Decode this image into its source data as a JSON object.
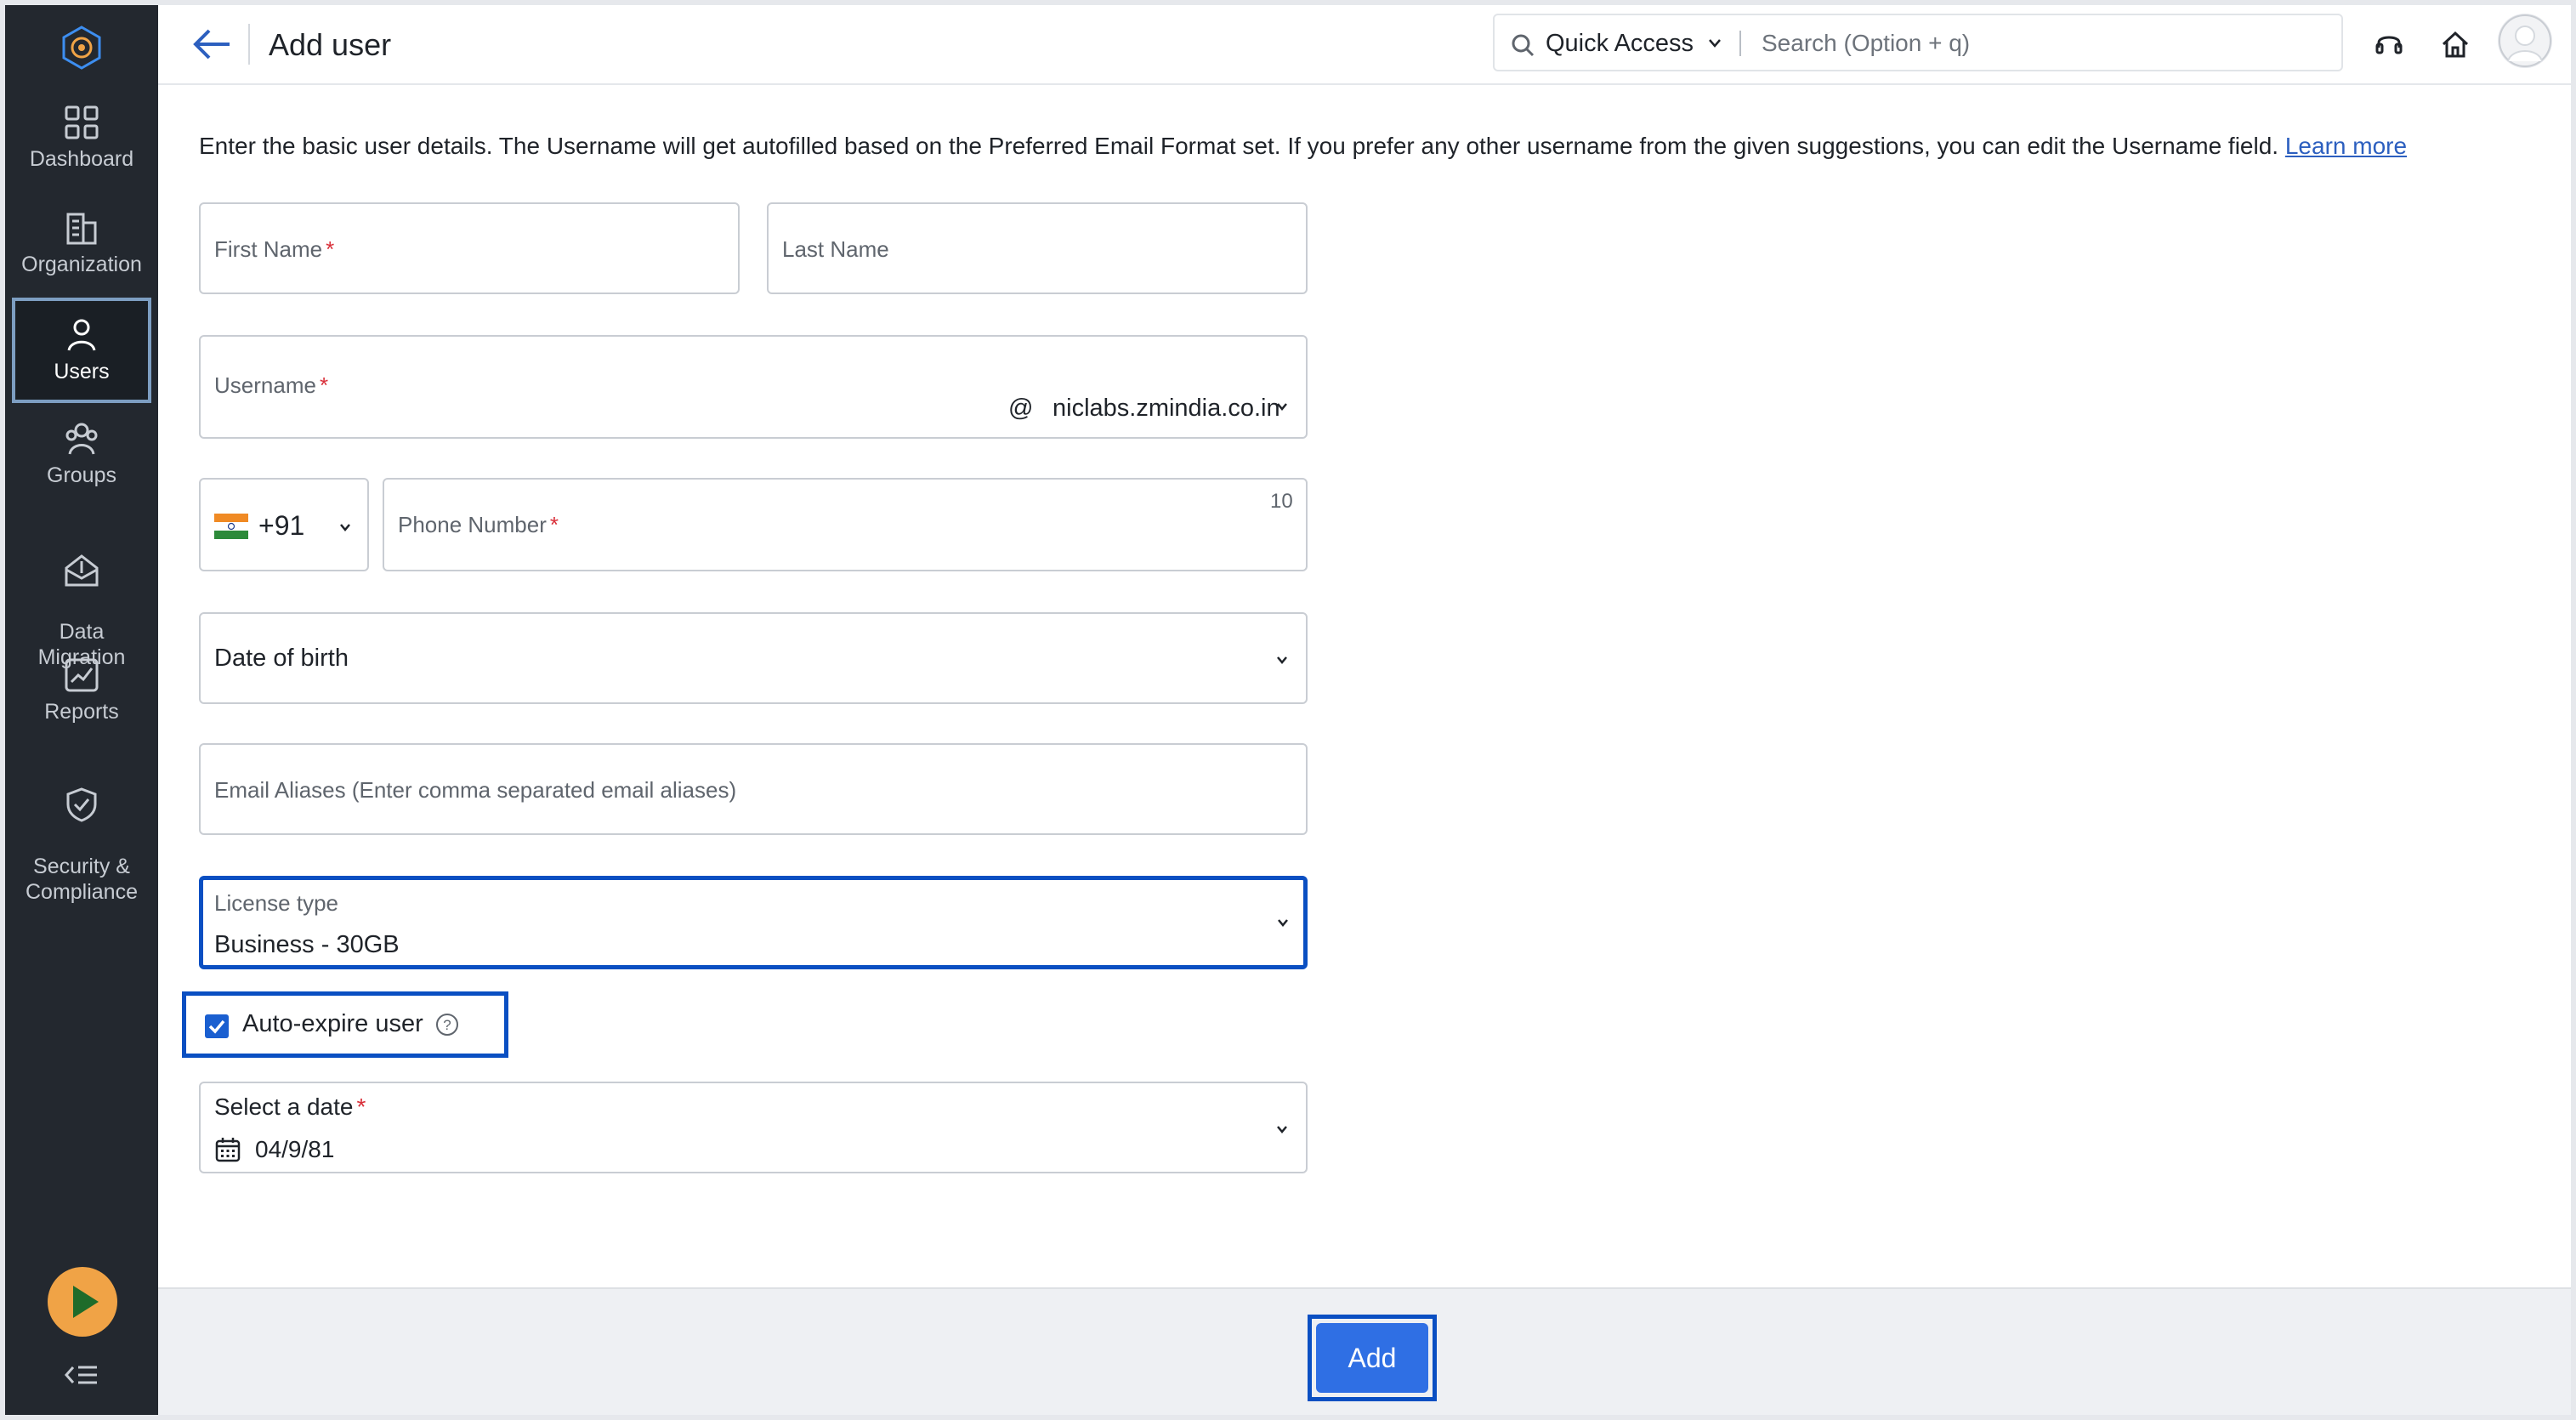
{
  "sidebar": {
    "items": [
      {
        "label": "Dashboard"
      },
      {
        "label": "Organization"
      },
      {
        "label": "Users"
      },
      {
        "label": "Groups"
      },
      {
        "label": "Data\nMigration"
      },
      {
        "label": "Reports"
      },
      {
        "label": "Security &\nCompliance"
      }
    ],
    "active": "Users"
  },
  "header": {
    "title": "Add user",
    "quick_access": "Quick Access",
    "search_placeholder": "Search (Option + q)"
  },
  "intro": {
    "text": "Enter the basic user details. The Username will get autofilled based on the Preferred Email Format set. If you prefer any other username from the given suggestions, you can edit the Username field.",
    "link": "Learn more"
  },
  "form": {
    "first_name": {
      "label": "First Name",
      "required_mark": "*"
    },
    "last_name": {
      "label": "Last Name"
    },
    "username": {
      "label": "Username",
      "required_mark": "*",
      "at": "@",
      "domain": "niclabs.zmindia.co.in"
    },
    "phone": {
      "country_code": "+91",
      "label": "Phone Number",
      "required_mark": "*",
      "max_length": "10"
    },
    "dob": {
      "label": "Date of birth"
    },
    "email_aliases": {
      "placeholder": "Email Aliases (Enter comma separated email aliases)"
    },
    "license": {
      "label": "License type",
      "value": "Business - 30GB"
    },
    "auto_expire": {
      "label": "Auto-expire user",
      "checked": true
    },
    "expiry_date": {
      "label": "Select a date",
      "required_mark": "*",
      "value": "04/9/81"
    }
  },
  "footer": {
    "add_label": "Add"
  },
  "colors": {
    "sidebar_bg": "#23282f",
    "accent": "#2f6fe4",
    "focus_border": "#0a4fc2",
    "required": "#d9303a",
    "play": "#f0a346"
  }
}
